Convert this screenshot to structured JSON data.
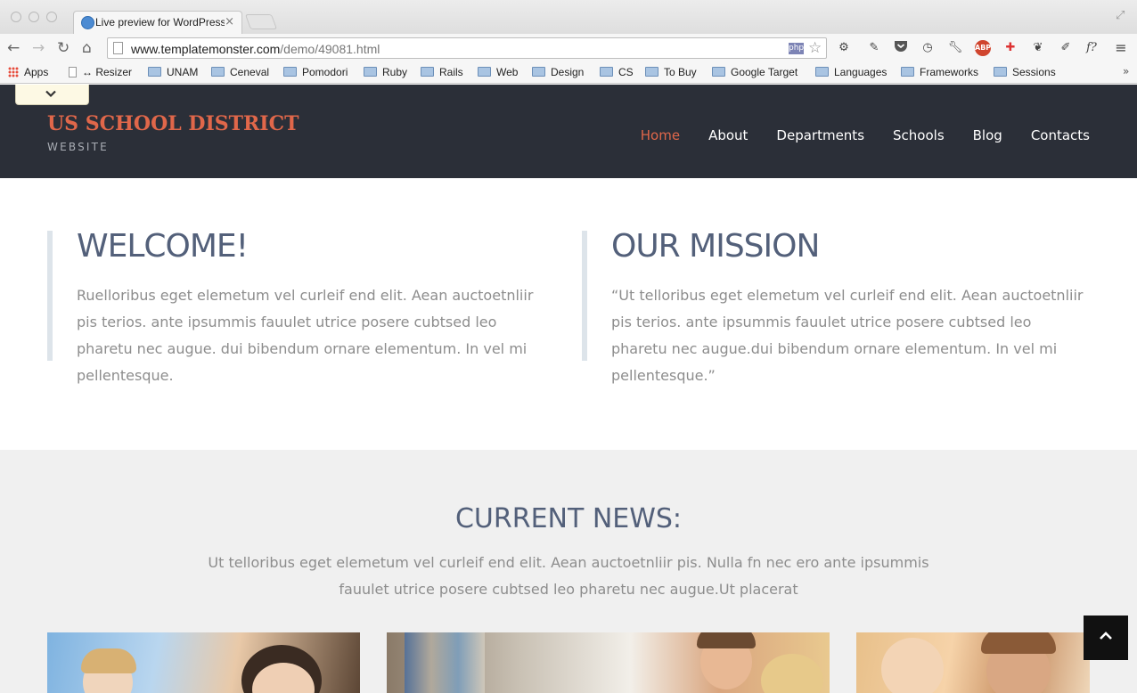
{
  "browser": {
    "tab_title": "Live preview for WordPress",
    "tab_close": "×",
    "url_domain": "www.templatemonster.com",
    "url_path": "/demo/49081.html",
    "php_badge": "php",
    "bookmarks": [
      {
        "label": "Apps",
        "icon": "apps-grid-icon"
      },
      {
        "label": "↔ Resizer",
        "icon": "page-icon"
      },
      {
        "label": "UNAM",
        "icon": "folder-icon"
      },
      {
        "label": "Ceneval",
        "icon": "folder-icon"
      },
      {
        "label": "Pomodori",
        "icon": "folder-icon"
      },
      {
        "label": "Ruby",
        "icon": "folder-icon"
      },
      {
        "label": "Rails",
        "icon": "folder-icon"
      },
      {
        "label": "Web",
        "icon": "folder-icon"
      },
      {
        "label": "Design",
        "icon": "folder-icon"
      },
      {
        "label": "CS",
        "icon": "folder-icon"
      },
      {
        "label": "To Buy",
        "icon": "folder-icon"
      },
      {
        "label": "Google Target",
        "icon": "folder-icon"
      },
      {
        "label": "Languages",
        "icon": "folder-icon"
      },
      {
        "label": "Frameworks",
        "icon": "folder-icon"
      },
      {
        "label": "Sessions",
        "icon": "folder-icon"
      }
    ],
    "more_bookmarks": "»",
    "extension_labels": {
      "abp": "ABP",
      "fx": "f?"
    }
  },
  "site": {
    "logo_title": "US SCHOOL DISTRICT",
    "logo_subtitle": "WEBSITE",
    "nav": [
      "Home",
      "About",
      "Departments",
      "Schools",
      "Blog",
      "Contacts"
    ],
    "active_nav": "Home",
    "accent_color": "#e0674a",
    "header_bg": "#2b2f38"
  },
  "welcome": {
    "heading": "WELCOME!",
    "text": "Ruelloribus eget elemetum vel curleif end elit. Aean auctoetnliir pis terios. ante ipsummis fauulet utrice posere cubtsed leo pharetu nec augue. dui bibendum ornare elementum. In vel mi pellentesque."
  },
  "mission": {
    "heading": "OUR MISSION",
    "text": "“Ut telloribus eget elemetum vel curleif end elit. Aean auctoetnliir pis terios. ante ipsummis fauulet utrice posere cubtsed leo pharetu nec augue.dui bibendum ornare elementum. In vel mi pellentesque.”"
  },
  "news": {
    "heading": "CURRENT NEWS:",
    "text": "Ut telloribus eget elemetum vel curleif end elit. Aean auctoetnliir pis. Nulla fn nec ero ante ipsummis fauulet utrice posere cubtsed leo pharetu nec augue.Ut placerat"
  }
}
